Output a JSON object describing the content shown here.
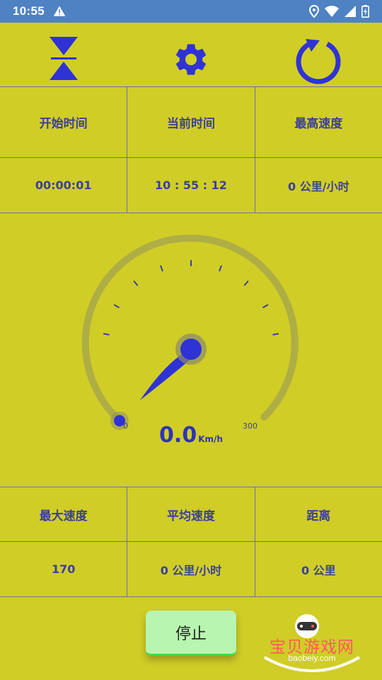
{
  "status_bar": {
    "time": "10:55"
  },
  "toolbar": {
    "collapse_icon": "collapse-icon",
    "settings_icon": "gear-icon",
    "refresh_icon": "refresh-icon"
  },
  "stats_top": {
    "headers": [
      "开始时间",
      "当前时间",
      "最高速度"
    ],
    "values": [
      "00:00:01",
      "10 : 55 : 12",
      "0 公里/小时"
    ]
  },
  "gauge": {
    "min_label": "0",
    "max_label": "300",
    "speed": "0.0",
    "unit": "Km/h",
    "current_value": 0,
    "range": [
      0,
      300
    ]
  },
  "stats_bottom": {
    "headers": [
      "最大速度",
      "平均速度",
      "距离"
    ],
    "values": [
      "170",
      "0 公里/小时",
      "0 公里"
    ]
  },
  "stop_button": {
    "label": "停止"
  },
  "watermark": {
    "text": "宝贝游戏网",
    "url": "baobeiy.com"
  },
  "colors": {
    "background": "#d0cd27",
    "status_bar": "#4f82c2",
    "accent": "#2f33d6",
    "text": "#3b3f9c",
    "stop_button": "#b8f5b0"
  }
}
